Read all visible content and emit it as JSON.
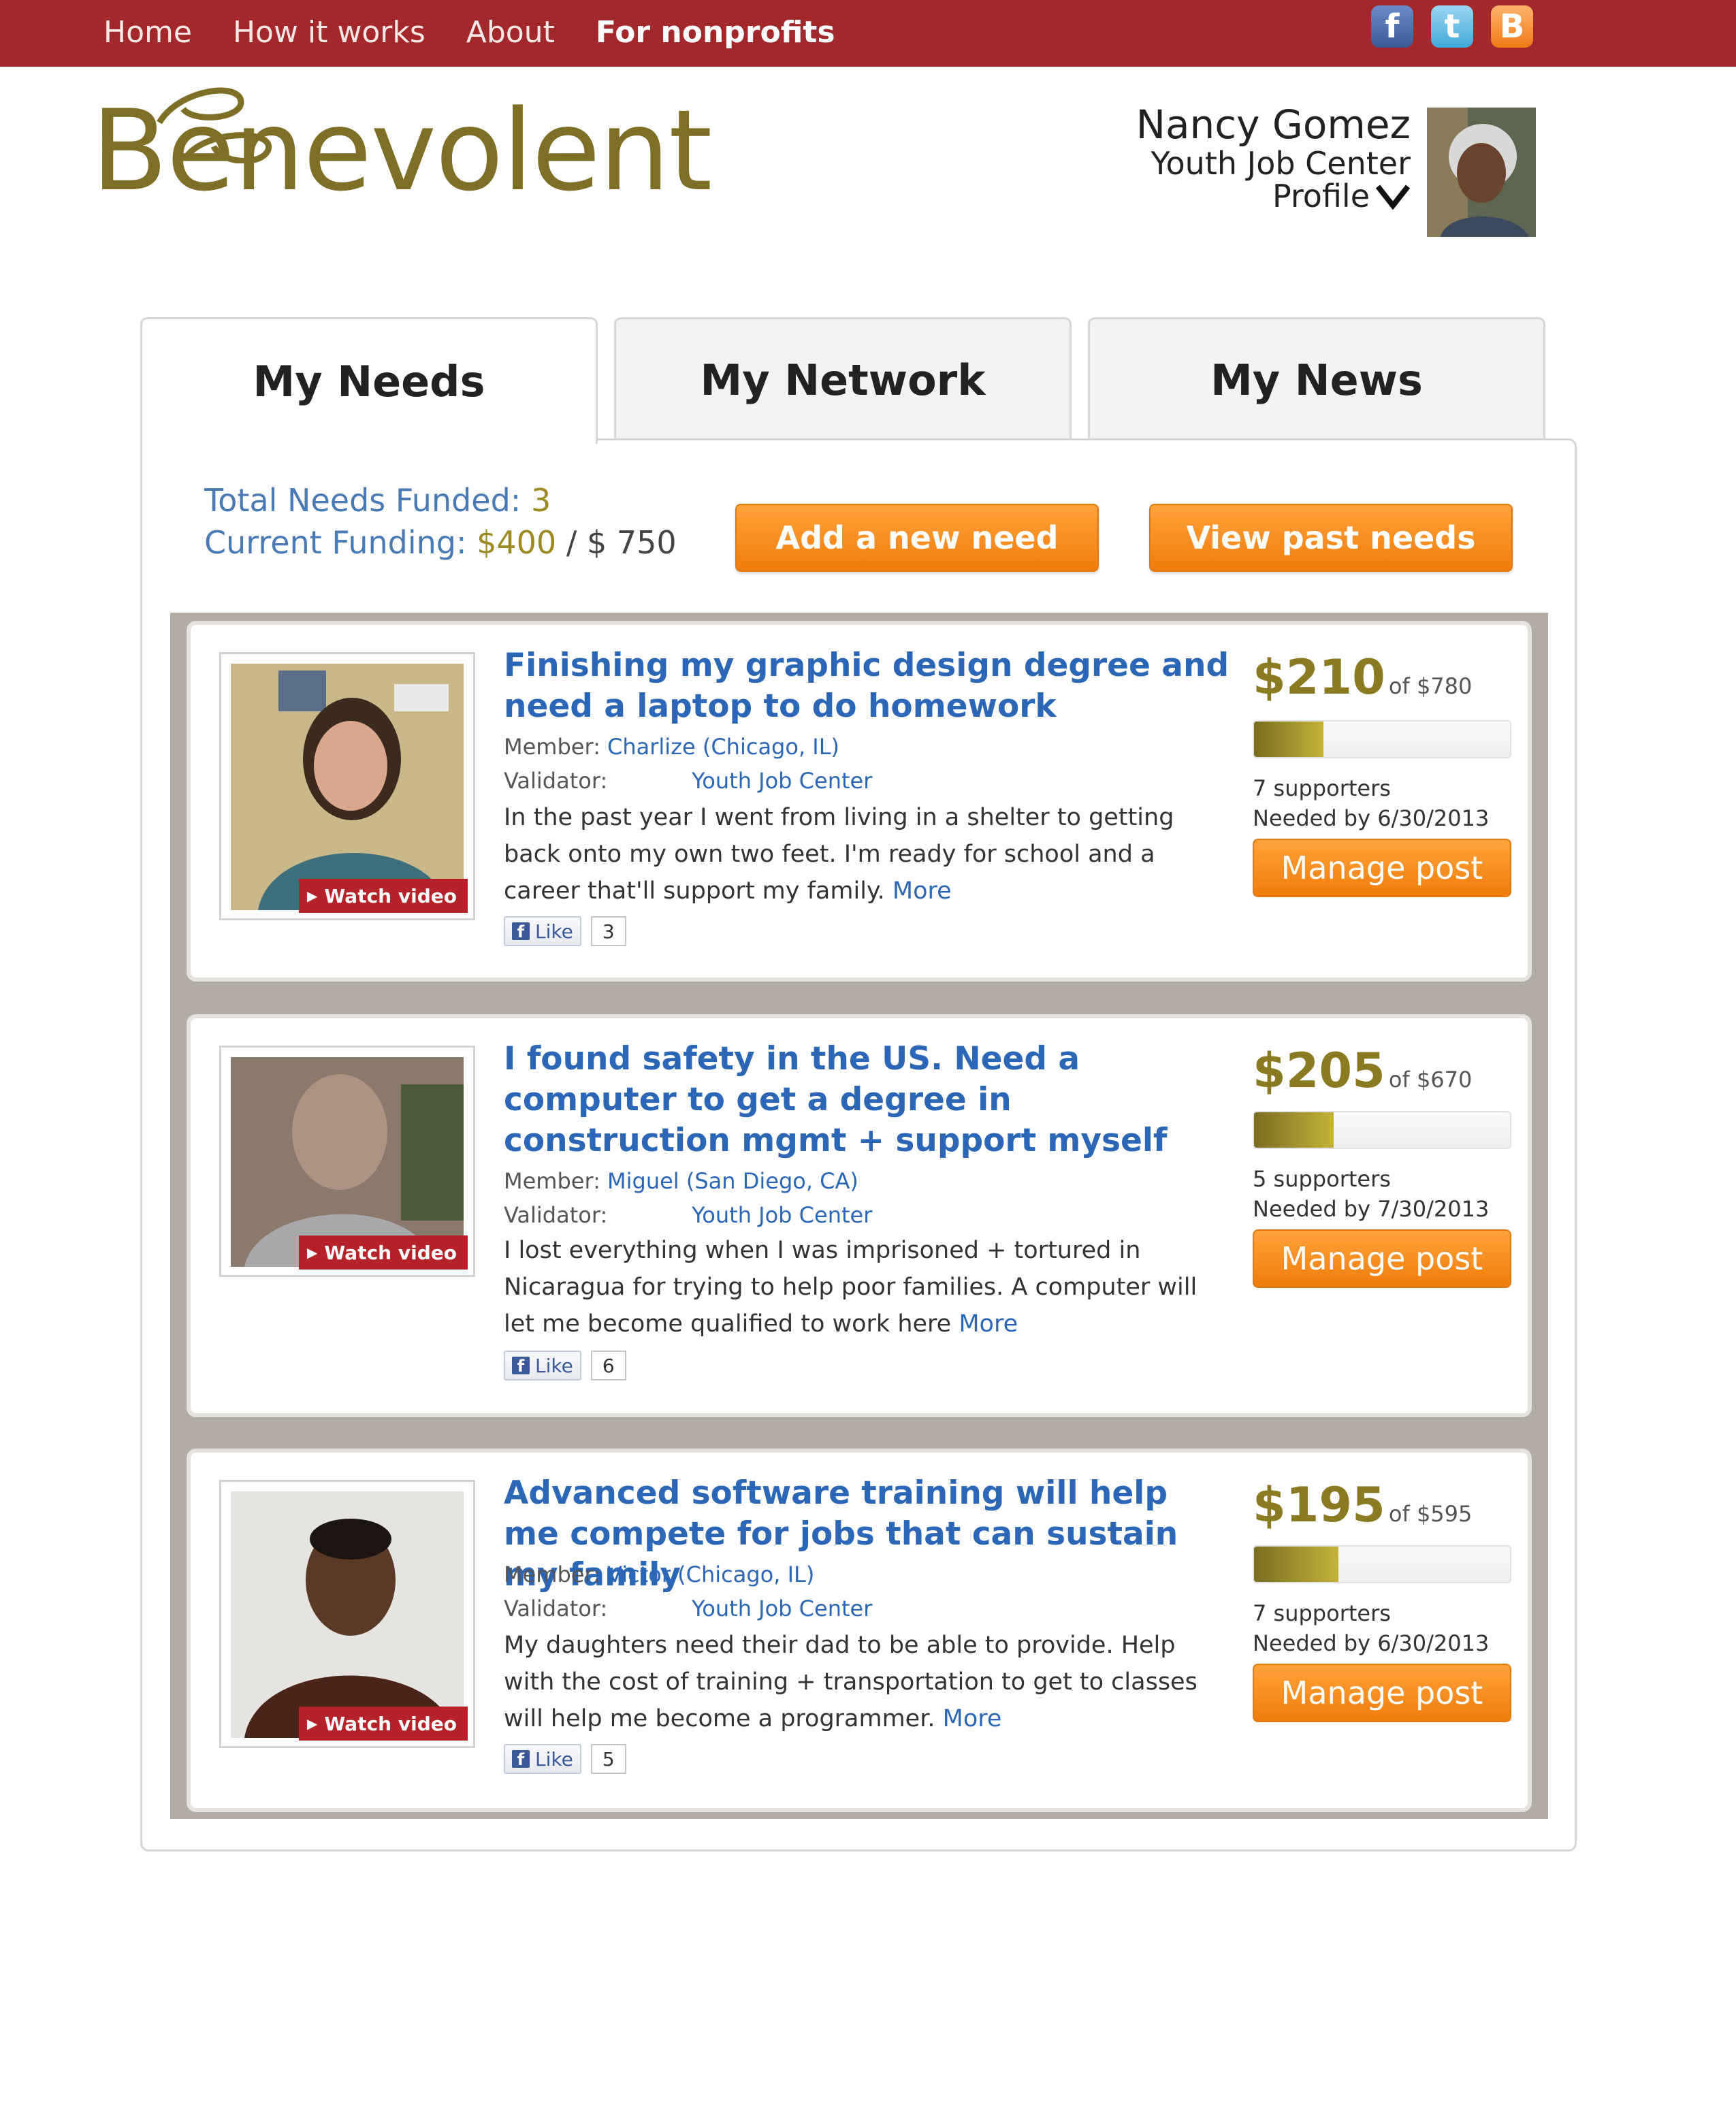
{
  "nav": {
    "items": [
      "Home",
      "How it works",
      "About",
      "For nonprofits"
    ],
    "active_index": 3,
    "social": [
      {
        "name": "facebook-icon",
        "glyph": "f"
      },
      {
        "name": "twitter-icon",
        "glyph": "t"
      },
      {
        "name": "blogger-icon",
        "glyph": "B"
      }
    ]
  },
  "brand": {
    "logo": "Benevolent",
    "color": "#7d6f26"
  },
  "profile": {
    "name": "Nancy Gomez",
    "org": "Youth Job Center",
    "link": "Profile"
  },
  "tabs": [
    {
      "label": "My Needs",
      "active": true
    },
    {
      "label": "My Network",
      "active": false
    },
    {
      "label": "My News",
      "active": false
    }
  ],
  "stats": {
    "funded_label": "Total Needs Funded:",
    "funded_value": "3",
    "funding_label": "Current Funding:",
    "funding_current": "$400",
    "funding_sep": "/",
    "funding_goal": "$ 750"
  },
  "actions": {
    "add": "Add a new need",
    "past": "View past needs"
  },
  "needs": [
    {
      "title": "Finishing my graphic design degree and need a laptop to do homework",
      "member_label": "Member:",
      "member": "Charlize (Chicago, IL)",
      "validator_label": "Validator:",
      "validator": "Youth Job Center",
      "description": "In the past year I went from living in a shelter to getting back onto my own two feet. I'm ready for school and a career that'll support my family.",
      "more": "More",
      "like_label": "Like",
      "likes": "3",
      "raised": "$210",
      "goal": "of $780",
      "progress": 0.27,
      "supporters": "7 supporters",
      "needed_by": "Needed by 6/30/2013",
      "manage": "Manage post",
      "watch": "Watch video"
    },
    {
      "title": "I found safety in the US. Need a computer to get a degree in construction mgmt + support myself",
      "member_label": "Member:",
      "member": "Miguel (San Diego, CA)",
      "validator_label": "Validator:",
      "validator": "Youth Job Center",
      "description": "I lost everything when I was imprisoned + tortured in Nicaragua for trying to help poor families. A computer will let me become qualified to work here",
      "more": "More",
      "like_label": "Like",
      "likes": "6",
      "raised": "$205",
      "goal": "of $670",
      "progress": 0.31,
      "supporters": "5 supporters",
      "needed_by": "Needed by 7/30/2013",
      "manage": "Manage post",
      "watch": "Watch video"
    },
    {
      "title": "Advanced software training will help me compete for jobs that can sustain my family",
      "member_label": "Member:",
      "member": "Victor (Chicago, IL)",
      "validator_label": "Validator:",
      "validator": "Youth Job Center",
      "description": "My daughters need their dad to be able to provide. Help with the cost of training + transportation to get to classes will help me become a programmer.",
      "more": "More",
      "like_label": "Like",
      "likes": "5",
      "raised": "$195",
      "goal": "of $595",
      "progress": 0.33,
      "supporters": "7 supporters",
      "needed_by": "Needed by 6/30/2013",
      "manage": "Manage post",
      "watch": "Watch video"
    }
  ],
  "colors": {
    "nav_bg": "#a3282c",
    "link_blue": "#2c67b7",
    "accent_orange": "#f07c0c",
    "gold": "#8a7a22"
  }
}
